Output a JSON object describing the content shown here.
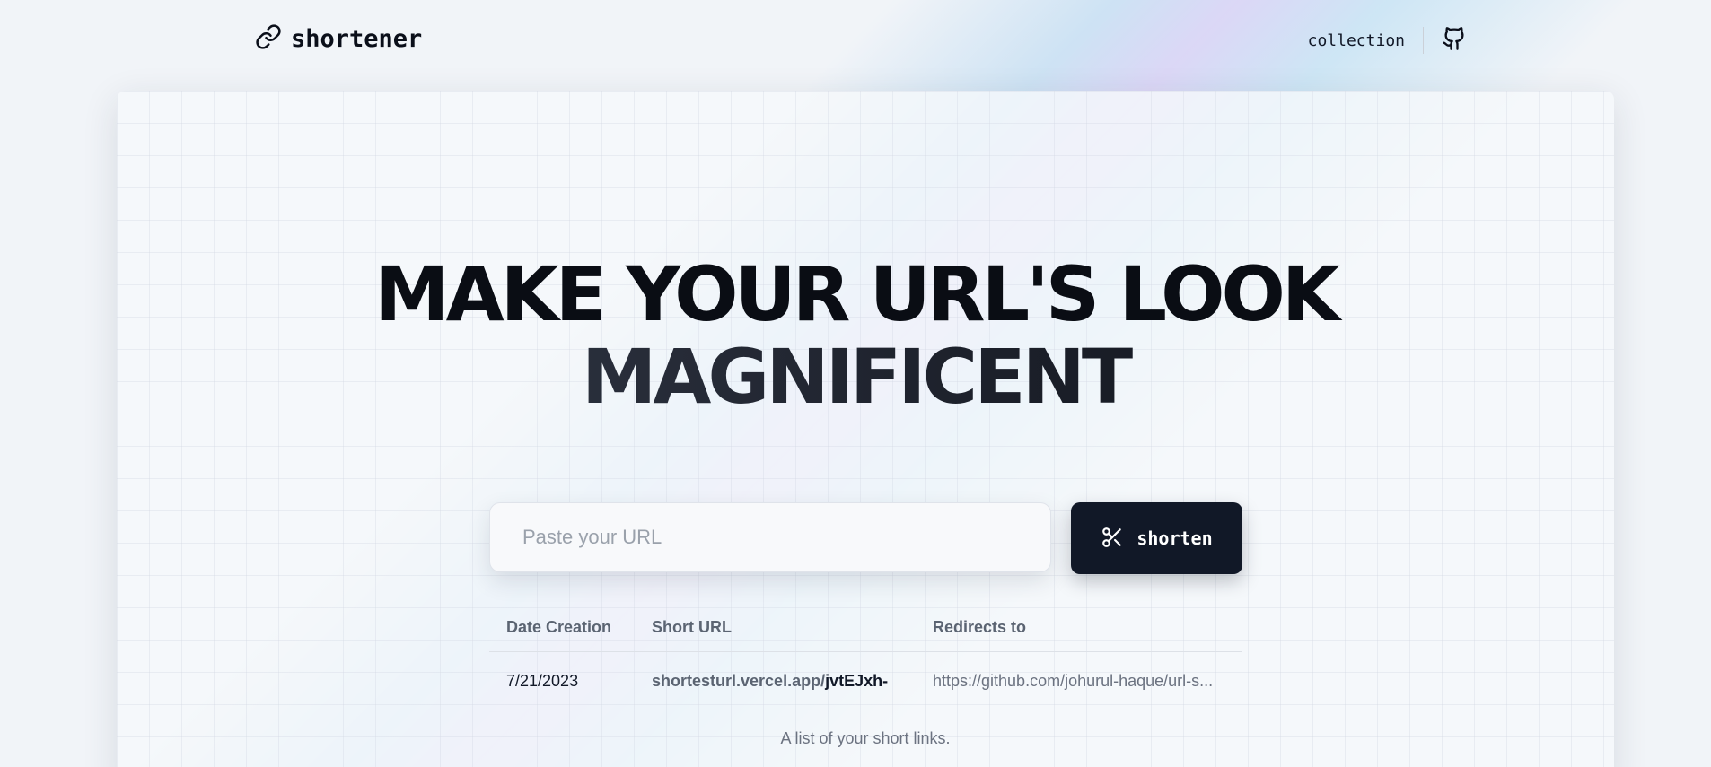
{
  "nav": {
    "brand": "shortener",
    "brand_icon": "link-icon",
    "collection_link": "collection",
    "github_icon": "github-icon"
  },
  "hero": {
    "line1": "MAKE YOUR URL'S LOOK",
    "line2": "MAGNIFICENT"
  },
  "form": {
    "placeholder": "Paste your URL",
    "value": "",
    "button_label": "shorten",
    "button_icon": "scissors-icon"
  },
  "table": {
    "headers": [
      "Date Creation",
      "Short URL",
      "Redirects to"
    ],
    "rows": [
      {
        "date": "7/21/2023",
        "short_prefix": "shortesturl.vercel.app/",
        "short_code": "jvtEJxh-",
        "redirect": "https://github.com/johurul-haque/url-s..."
      }
    ],
    "caption": "A list of your short links."
  },
  "colors": {
    "background": "#f1f4f8",
    "button": "#111827",
    "heading": "#0a0d14",
    "muted_text": "#6b7280"
  }
}
